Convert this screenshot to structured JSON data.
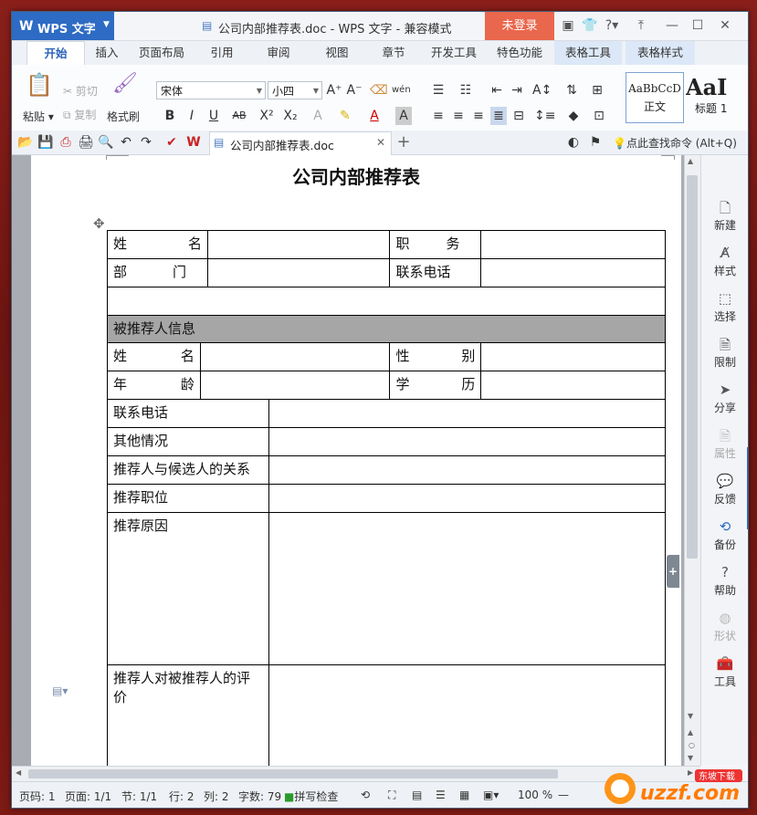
{
  "app": {
    "name": "WPS 文字",
    "login": "未登录"
  },
  "window": {
    "title": "公司内部推荐表.doc - WPS 文字 - 兼容模式"
  },
  "tabs": [
    "开始",
    "插入",
    "页面布局",
    "引用",
    "审阅",
    "视图",
    "章节",
    "开发工具",
    "特色功能",
    "表格工具",
    "表格样式"
  ],
  "ribbon": {
    "paste": "粘贴",
    "cut": "剪切",
    "copy": "复制",
    "format_painter": "格式刷",
    "font": "宋体",
    "font_size": "小四",
    "styles": [
      {
        "preview": "AaBbCcD",
        "name": "正文"
      },
      {
        "preview": "AaI",
        "name": "标题 1"
      }
    ]
  },
  "doc_tab": {
    "label": "公司内部推荐表.doc"
  },
  "command_search": "点此查找命令 (Alt+Q)",
  "document": {
    "heading": "公司内部推荐表",
    "table1": {
      "name_label": [
        "姓",
        "名"
      ],
      "position_label": [
        "职",
        "务"
      ],
      "dept_label": [
        "部",
        "门"
      ],
      "phone_label": "联系电话"
    },
    "section_header": "被推荐人信息",
    "table2": {
      "name_label": [
        "姓",
        "名"
      ],
      "gender_label": [
        "性",
        "别"
      ],
      "age_label": [
        "年",
        "龄"
      ],
      "edu_label": [
        "学",
        "历"
      ],
      "rows": [
        "联系电话",
        "其他情况",
        "推荐人与候选人的关系",
        "推荐职位",
        "推荐原因",
        "推荐人对被推荐人的评价"
      ]
    }
  },
  "side_panel": [
    "新建",
    "样式",
    "选择",
    "限制",
    "分享",
    "属性",
    "反馈",
    "备份",
    "帮助",
    "形状",
    "工具"
  ],
  "status": {
    "page_num": "页码: 1",
    "pages": "页面: 1/1",
    "section": "节: 1/1",
    "row": "行: 2",
    "col": "列: 2",
    "words": "字数: 79",
    "spell": "拼写检查",
    "zoom": "100 %"
  },
  "watermark": "东坡下载 uzzf.com"
}
